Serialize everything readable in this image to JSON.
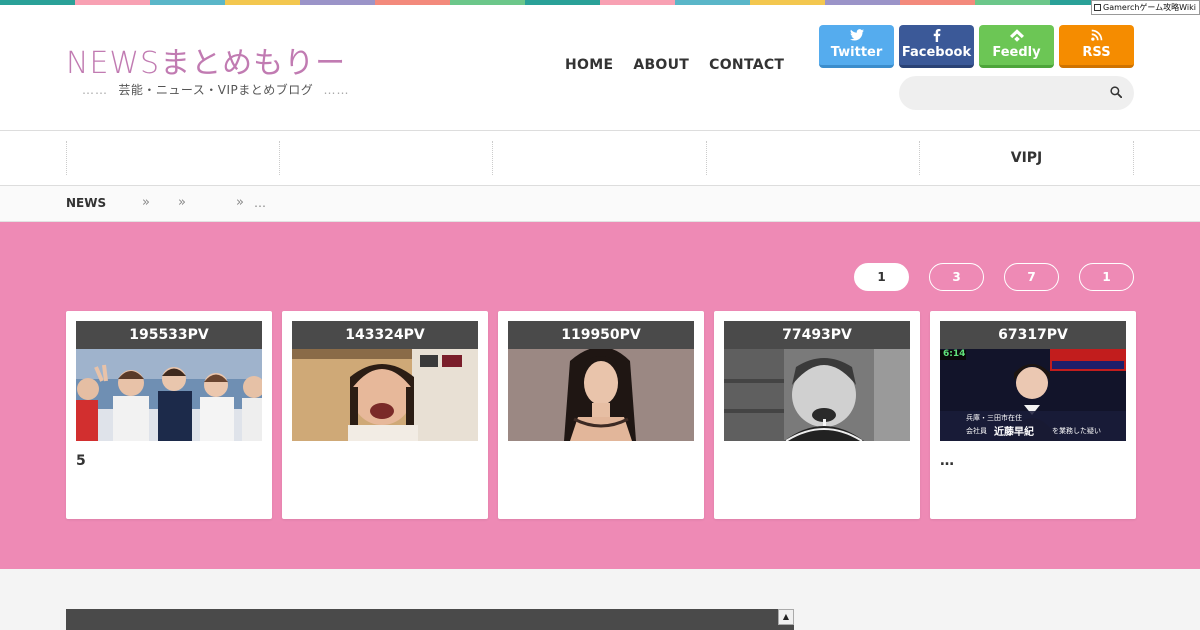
{
  "stripe_colors": [
    "#2aa198",
    "#f8a1b3",
    "#5ab6c8",
    "#f3c74f",
    "#9b94c8",
    "#f38a7c",
    "#6cc78a",
    "#2aa198",
    "#f8a1b3",
    "#5ab6c8",
    "#f3c74f",
    "#9b94c8",
    "#f38a7c",
    "#6cc78a",
    "#2aa198",
    "#f8a1b3"
  ],
  "badge": {
    "text": "Gamerchゲーム攻略Wiki"
  },
  "header": {
    "logo": "NEWSまとめもりー",
    "tagline_dots_left": "……",
    "tagline": "芸能・ニュース・VIPまとめブログ",
    "tagline_dots_right": "……"
  },
  "nav": [
    {
      "label": "HOME"
    },
    {
      "label": "ABOUT"
    },
    {
      "label": "CONTACT"
    }
  ],
  "social": [
    {
      "label": "Twitter",
      "icon": "twitter-icon",
      "color": "#55acee"
    },
    {
      "label": "Facebook",
      "icon": "facebook-icon",
      "color": "#3b5998"
    },
    {
      "label": "Feedly",
      "icon": "feedly-icon",
      "color": "#6cc655"
    },
    {
      "label": "RSS",
      "icon": "rss-icon",
      "color": "#f58c00"
    }
  ],
  "search": {
    "placeholder": ""
  },
  "categories": [
    {
      "label": ""
    },
    {
      "label": ""
    },
    {
      "label": ""
    },
    {
      "label": ""
    },
    {
      "label": "VIPJ"
    }
  ],
  "breadcrumb": {
    "home": "NEWS",
    "sep": "»",
    "last": "…"
  },
  "ranking": {
    "accent": "#ee8ab5",
    "tabs": [
      {
        "label": "1",
        "active": true
      },
      {
        "label": "3",
        "active": false
      },
      {
        "label": "7",
        "active": false
      },
      {
        "label": "1",
        "active": false
      }
    ],
    "cards": [
      {
        "pv": "195533PV",
        "title": "5"
      },
      {
        "pv": "143324PV",
        "title": ""
      },
      {
        "pv": "119950PV",
        "title": ""
      },
      {
        "pv": "77493PV",
        "title": ""
      },
      {
        "pv": "67317PV",
        "title": "…"
      }
    ],
    "card5_overlay": {
      "time": "6:14",
      "caption1": "兵庫・三田市在住",
      "caption2": "会社員",
      "caption3": "近藤早紀",
      "caption4": "を業務した疑い"
    }
  }
}
